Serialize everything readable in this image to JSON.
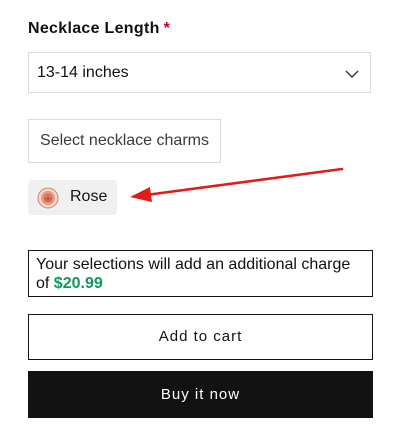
{
  "necklace_length": {
    "label": "Necklace Length",
    "required_marker": "*",
    "selected_value": "13-14 inches",
    "dropdown_icon": "chevron-down-icon"
  },
  "charms": {
    "select_button_label": "Select necklace charms",
    "selected_chips": [
      {
        "label": "Rose",
        "icon": "rose-charm-icon"
      }
    ]
  },
  "annotation": {
    "arrow_color": "#e31b1b",
    "icon": "red-arrow-icon"
  },
  "notice": {
    "text": "Your selections will add an additional charge of",
    "price": "$20.99",
    "price_color": "#0f9a5a"
  },
  "actions": {
    "add_to_cart_label": "Add to cart",
    "buy_now_label": "Buy it now"
  },
  "colors": {
    "required": "#d0021b",
    "button_dark": "#121212"
  }
}
